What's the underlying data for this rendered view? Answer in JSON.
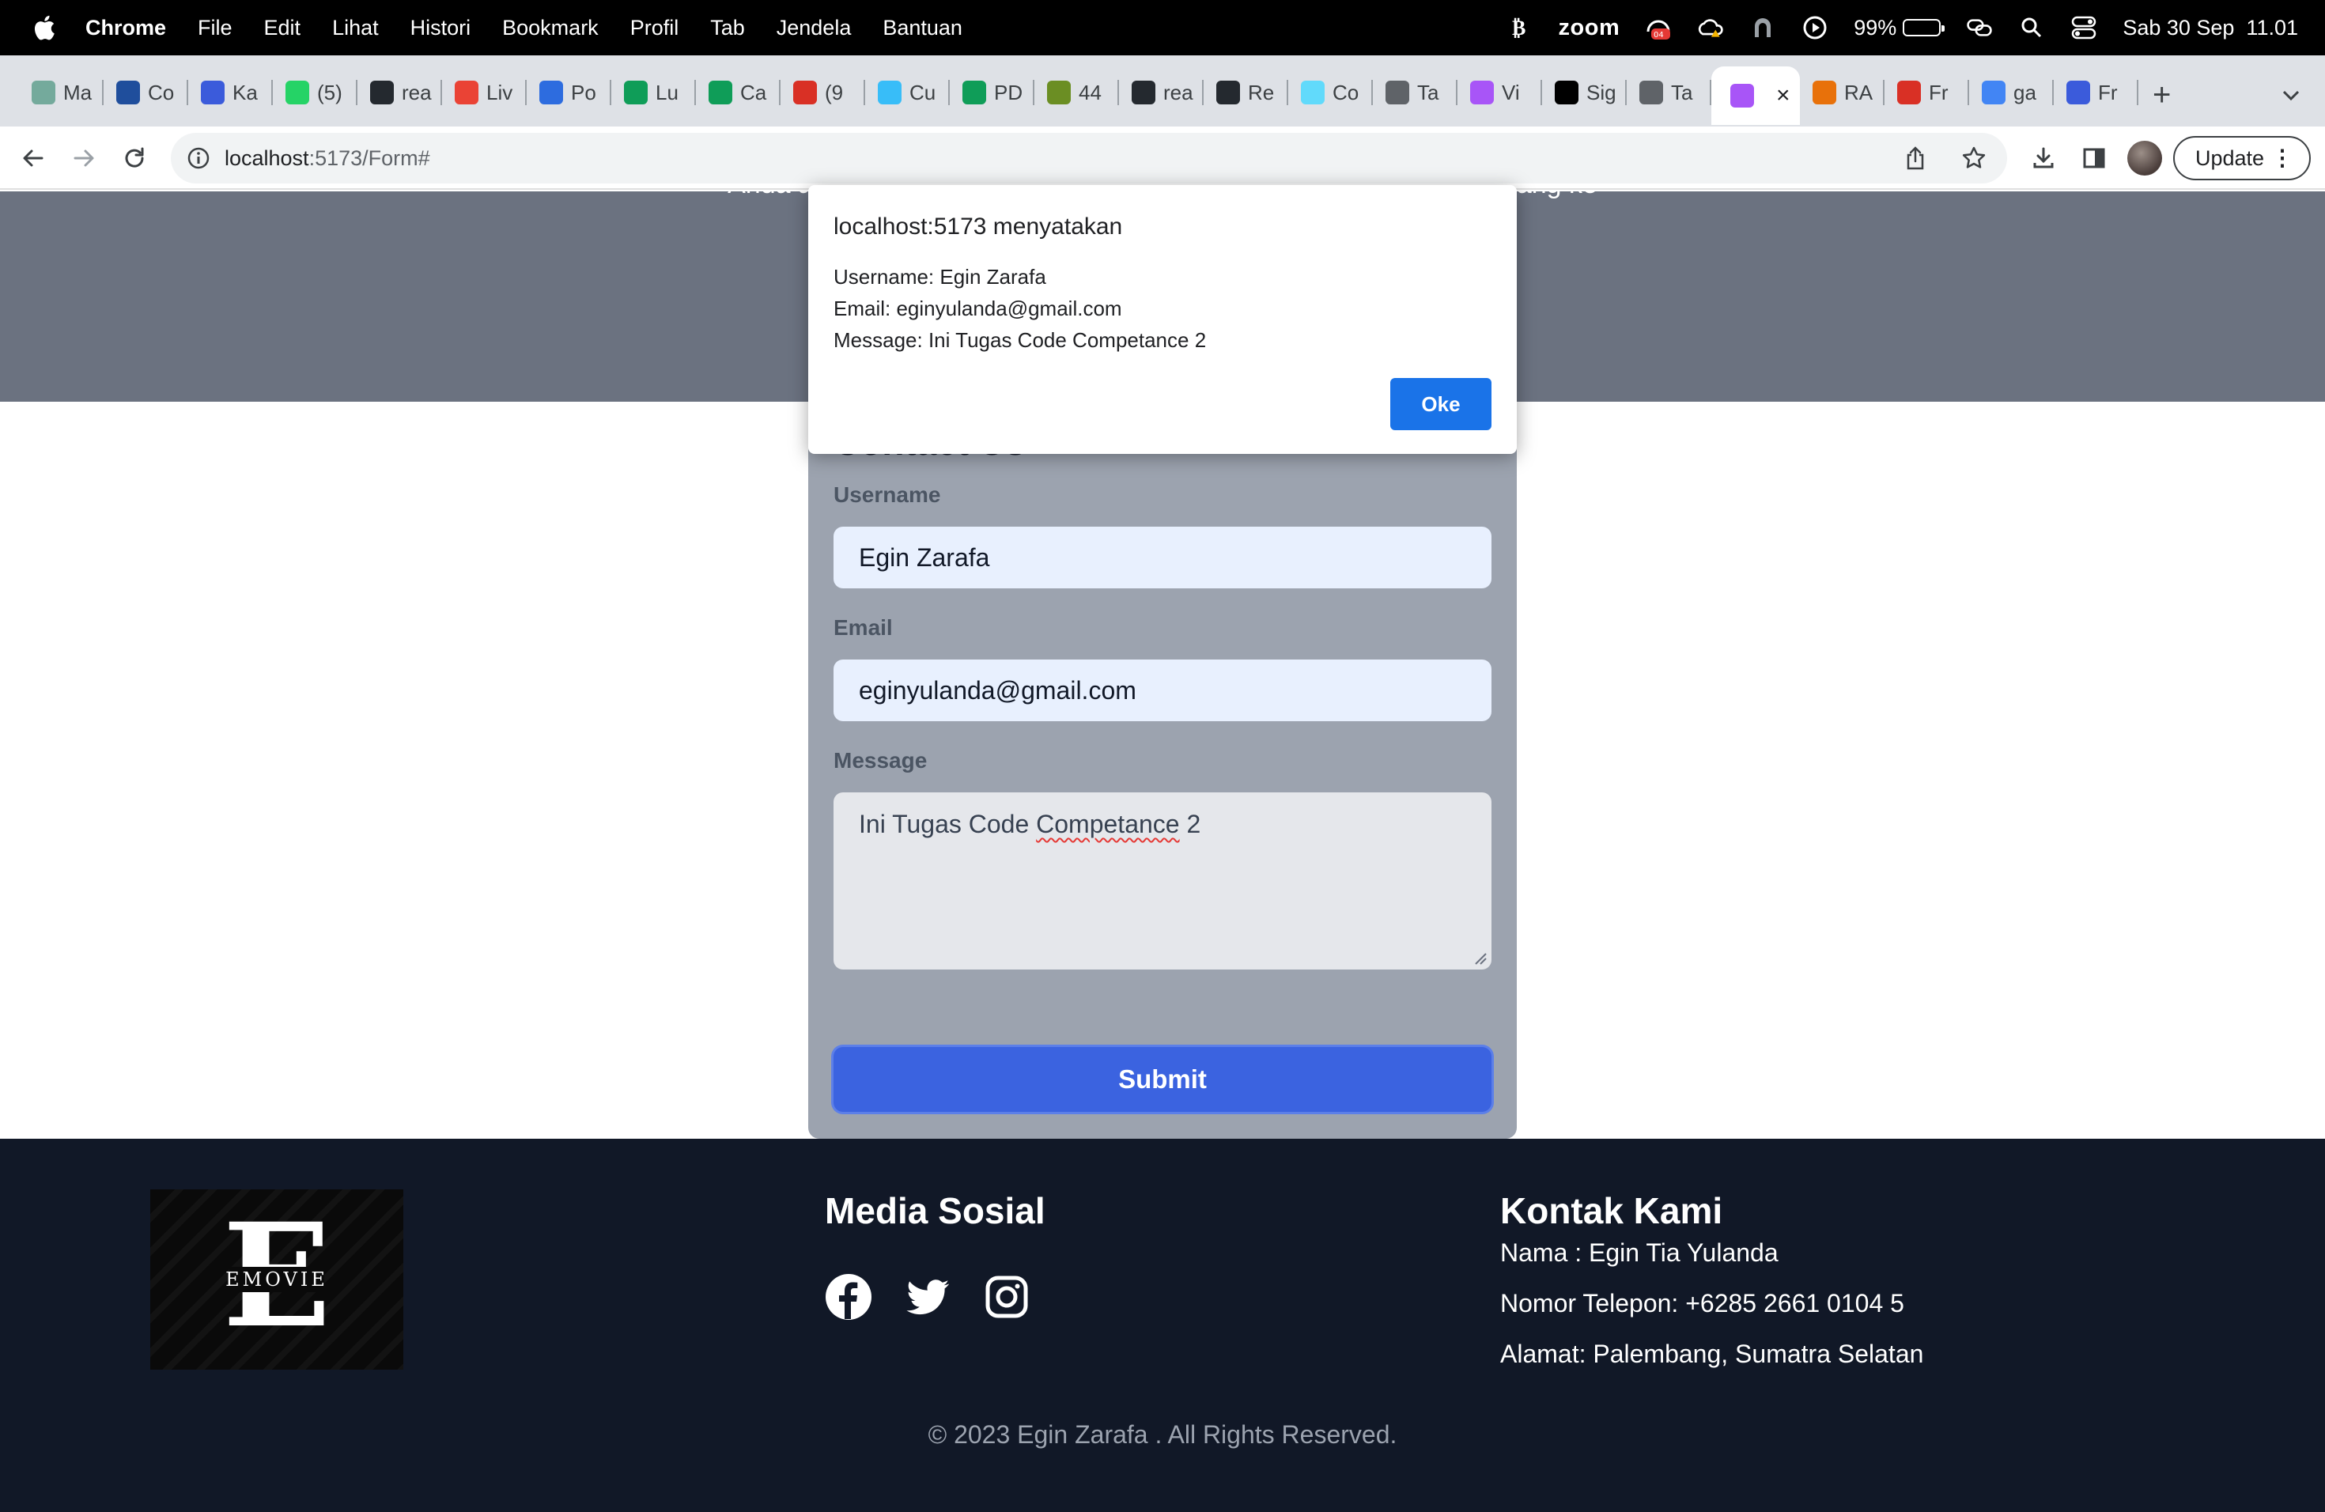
{
  "menubar": {
    "app_name": "Chrome",
    "items": [
      "File",
      "Edit",
      "Lihat",
      "Histori",
      "Bookmark",
      "Profil",
      "Tab",
      "Jendela",
      "Bantuan"
    ],
    "zoom_label": "zoom",
    "zoom_badge": "04",
    "battery_percent": "99%",
    "battery_level": 0.99,
    "datetime": "Sab 30 Sep  11.01"
  },
  "tabs": [
    {
      "label": "Ma",
      "icon": "chatgpt-icon",
      "color": "#74aa9c"
    },
    {
      "label": "Co",
      "icon": "onedrive-icon",
      "color": "#1f4e9c"
    },
    {
      "label": "Ka",
      "icon": "kampus-icon",
      "color": "#3b5bdb"
    },
    {
      "label": "(5)",
      "icon": "whatsapp-icon",
      "color": "#25d366"
    },
    {
      "label": "rea",
      "icon": "github-icon",
      "color": "#24292f"
    },
    {
      "label": "Liv",
      "icon": "gmail-icon",
      "color": "#ea4335"
    },
    {
      "label": "Po",
      "icon": "zotero-icon",
      "color": "#2d6cdf"
    },
    {
      "label": "Lu",
      "icon": "drive-icon",
      "color": "#0f9d58"
    },
    {
      "label": "Ca",
      "icon": "drive-icon",
      "color": "#0f9d58"
    },
    {
      "label": "(9",
      "icon": "badge-909-icon",
      "color": "#d93025"
    },
    {
      "label": "Cu",
      "icon": "tailwind-icon",
      "color": "#38bdf8"
    },
    {
      "label": "PD",
      "icon": "drive-icon",
      "color": "#0f9d58"
    },
    {
      "label": "44",
      "icon": "portal-icon",
      "color": "#6b8e23"
    },
    {
      "label": "rea",
      "icon": "github-icon",
      "color": "#24292f"
    },
    {
      "label": "Re",
      "icon": "github-icon",
      "color": "#24292f"
    },
    {
      "label": "Co",
      "icon": "react-icon",
      "color": "#61dafb"
    },
    {
      "label": "Ta",
      "icon": "chrome-icon",
      "color": "#5f6368"
    },
    {
      "label": "Vi",
      "icon": "vite-icon",
      "color": "#a855f7"
    },
    {
      "label": "Sig",
      "icon": "vercel-icon",
      "color": "#000000"
    },
    {
      "label": "Ta",
      "icon": "globe-icon",
      "color": "#5f6368"
    },
    {
      "label": "",
      "icon": "vite-icon",
      "color": "#a855f7",
      "active": true
    },
    {
      "label": "RA",
      "icon": "wallet-icon",
      "color": "#e8710a"
    },
    {
      "label": "Fr",
      "icon": "s-icon",
      "color": "#d93025"
    },
    {
      "label": "ga",
      "icon": "google-icon",
      "color": "#4285f4"
    },
    {
      "label": "Fr",
      "icon": "forms-icon",
      "color": "#3b5bdb"
    }
  ],
  "toolbar": {
    "url_host": "localhost",
    "url_path": ":5173/Form#",
    "update_label": "Update"
  },
  "hero": {
    "text": "Anda atau ar                                                                              embang ke"
  },
  "form": {
    "title": "Contact Us",
    "username_label": "Username",
    "username_value": "Egin Zarafa",
    "email_label": "Email",
    "email_value": "eginyulanda@gmail.com",
    "message_label": "Message",
    "message_value_pre": "Ini Tugas Code ",
    "message_value_misspelled": "Competance",
    "message_value_post": " 2",
    "submit_label": "Submit"
  },
  "footer": {
    "logo_letter": "E",
    "logo_text": "EMOVIE",
    "social_heading": "Media Sosial",
    "social_icons": [
      "facebook-icon",
      "twitter-icon",
      "instagram-icon"
    ],
    "contact_heading": "Kontak Kami",
    "contact_name": "Nama : Egin Tia Yulanda",
    "contact_phone": "Nomor Telepon: +6285 2661 0104 5",
    "contact_address": "Alamat: Palembang, Sumatra Selatan",
    "copyright": "© 2023 Egin Zarafa . All Rights Reserved."
  },
  "dialog": {
    "title": "localhost:5173 menyatakan",
    "line1": "Username: Egin Zarafa",
    "line2": "Email: eginyulanda@gmail.com",
    "line3": "Message: Ini Tugas Code Competance 2",
    "ok_label": "Oke"
  },
  "colors": {
    "hero_bg": "#6b7280",
    "form_bg": "#9ca3af",
    "submit_bg": "#3b63e0",
    "footer_bg": "#111827",
    "dialog_ok": "#1a73e8"
  }
}
